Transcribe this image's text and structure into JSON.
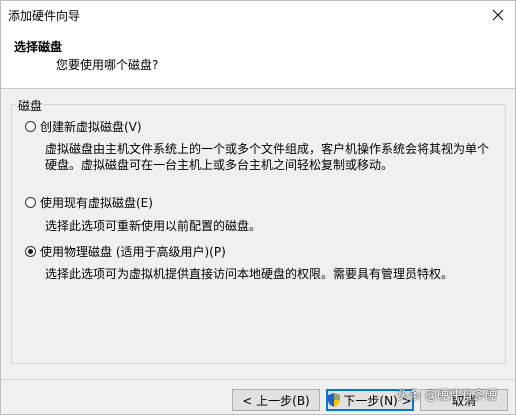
{
  "window": {
    "title": "添加硬件向导"
  },
  "header": {
    "title": "选择磁盘",
    "subtitle": "您要使用哪个磁盘?"
  },
  "group": {
    "label": "磁盘",
    "options": [
      {
        "label": "创建新虚拟磁盘(V)",
        "selected": false,
        "desc_lines": [
          "虚拟磁盘由主机文件系统上的一个或多个文件组成，客户机操作系统会将其视为单个",
          "硬盘。虚拟磁盘可在一台主机上或多台主机之间轻松复制或移动。"
        ]
      },
      {
        "label": "使用现有虚拟磁盘(E)",
        "selected": false,
        "desc_lines": [
          "选择此选项可重新使用以前配置的磁盘。"
        ]
      },
      {
        "label": "使用物理磁盘 (适用于高级用户)(P)",
        "selected": true,
        "desc_lines": [
          "选择此选项可为虚拟机提供直接访问本地硬盘的权限。需要具有管理员特权。"
        ]
      }
    ]
  },
  "footer": {
    "back_label": "< 上一步(B)",
    "next_label": "下一步(N) >",
    "cancel_label": "取消"
  },
  "watermark": "头条 @硬件有多硬"
}
